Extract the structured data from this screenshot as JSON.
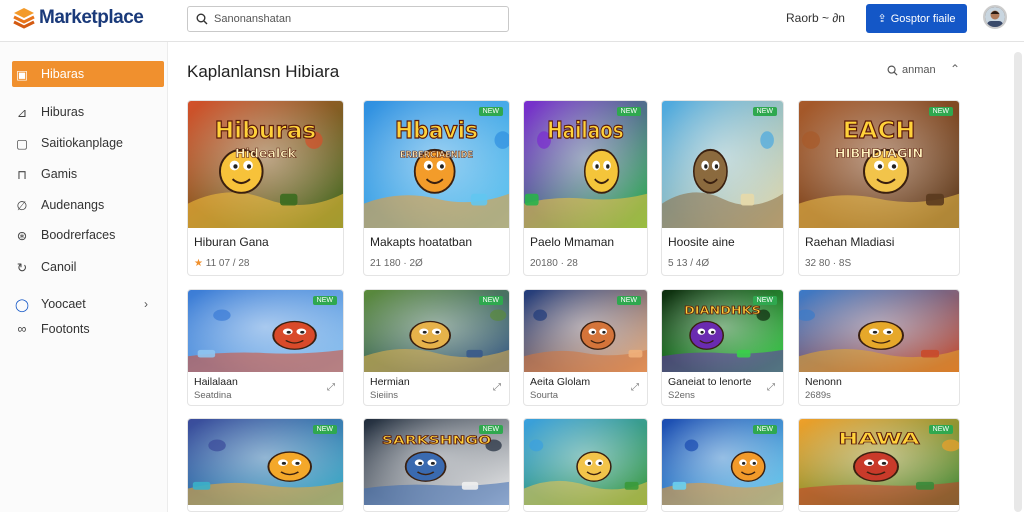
{
  "header": {
    "logo_text": "Marketplace",
    "search_placeholder": "Sanonanshatan",
    "link_label": "Raorb ~ ∂n",
    "button_label": "Gosptor fiaile"
  },
  "sidebar": {
    "items": [
      {
        "label": "Hibaras",
        "icon": "store-icon",
        "active": true
      },
      {
        "label": "Hiburas",
        "icon": "chart-icon"
      },
      {
        "label": "Saitiokanplage",
        "icon": "document-icon"
      },
      {
        "label": "Gamis",
        "icon": "bag-icon"
      },
      {
        "label": "Audenangs",
        "icon": "link-icon"
      },
      {
        "label": "Boodrerfaces",
        "icon": "puzzle-icon"
      },
      {
        "label": "Canoil",
        "icon": "refresh-icon"
      },
      {
        "label": "Yoocaet",
        "icon": "chat-icon"
      },
      {
        "label": "Footonts",
        "icon": "infinity-icon"
      }
    ]
  },
  "main": {
    "title": "Kaplanlansn Hibiara",
    "search_label": "anman",
    "rows": [
      [
        {
          "title": "Hiburan Gana",
          "meta": "11 07 / 28",
          "star": true,
          "thumb_text": "Hiburas",
          "thumb_sub": "Hidealck",
          "palette": [
            "#d4502a",
            "#f7c23a",
            "#3a6b1f"
          ]
        },
        {
          "title": "Makapts hoatatban",
          "meta": "21 180 · 2Ø",
          "badge": "NEW",
          "thumb_text": "Hbavis",
          "thumb_sub": "ERBERCIAENIDE",
          "palette": [
            "#2f8fe0",
            "#f39c2a",
            "#62c6f0"
          ]
        },
        {
          "title": "Paelo Mmaman",
          "meta": "20180 · 28",
          "badge": "NEW",
          "thumb_text": "Hailaos",
          "thumb_sub": "",
          "palette": [
            "#7a2bd0",
            "#f4c53a",
            "#29b34a"
          ]
        },
        {
          "title": "Hoosite aine",
          "meta": "5 13 / 4Ø",
          "badge": "NEW",
          "thumb_text": "",
          "thumb_sub": "",
          "palette": [
            "#4aa8e0",
            "#8b6a3e",
            "#e7d9a8"
          ]
        },
        {
          "title": "Raehan Mladiasi",
          "meta": "32 80 · 8S",
          "badge": "NEW",
          "thumb_text": "EACH",
          "thumb_sub": "HIBHDIAGIN",
          "palette": [
            "#a85a2a",
            "#f2c44a",
            "#5a3a1e"
          ]
        }
      ],
      [
        {
          "title": "Hailalaan",
          "sub": "Seatdina",
          "badge": "NEW",
          "palette": [
            "#3a7bd5",
            "#d94a2a",
            "#8fc4f0"
          ]
        },
        {
          "title": "Hermian",
          "sub": "Sieiins",
          "badge": "NEW",
          "palette": [
            "#5a8a3a",
            "#e6b24a",
            "#3a5a8a"
          ]
        },
        {
          "title": "Aeita Glolam",
          "sub": "Sourta",
          "badge": "NEW",
          "palette": [
            "#1f3a7a",
            "#d4743a",
            "#f0b07a"
          ]
        },
        {
          "title": "Ganeiat to lenorte",
          "sub": "S2ens",
          "badge": "NEW",
          "thumb_text": "DIANDHKS",
          "palette": [
            "#0d2a0d",
            "#6a2bb0",
            "#3ad04a"
          ]
        },
        {
          "title": "Nenonn",
          "sub": "2689s",
          "palette": [
            "#3a7ac9",
            "#e6a82a",
            "#c94a2a"
          ]
        }
      ],
      [
        {
          "palette": [
            "#3a4a9a",
            "#f4a82a",
            "#3ab0c9"
          ],
          "badge": "NEW"
        },
        {
          "palette": [
            "#1e2a3a",
            "#3a6ab0",
            "#f0f0f0"
          ],
          "badge": "NEW",
          "thumb_text": "SARKSHNGO"
        },
        {
          "palette": [
            "#3aa0e0",
            "#f2c44a",
            "#3a9a3a"
          ]
        },
        {
          "palette": [
            "#1a4ab0",
            "#f29a2a",
            "#6ad0f0"
          ],
          "badge": "NEW"
        },
        {
          "palette": [
            "#f0a02a",
            "#c93a2a",
            "#3a8a3a"
          ],
          "badge": "NEW",
          "thumb_text": "HAWA"
        }
      ]
    ]
  }
}
